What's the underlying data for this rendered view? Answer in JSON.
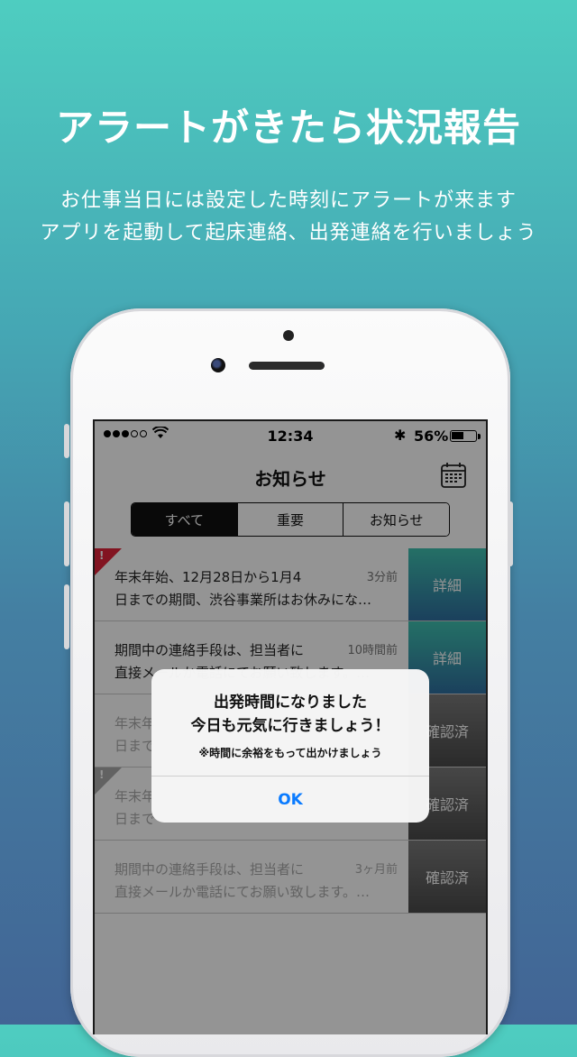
{
  "promo": {
    "headline": "アラートがきたら状況報告",
    "subtitle_line1": "お仕事当日には設定した時刻にアラートが来ます",
    "subtitle_line2": "アプリを起動して起床連絡、出発連絡を行いましょう"
  },
  "status_bar": {
    "time": "12:34",
    "battery_percent_label": "56%",
    "battery_level": 0.56,
    "signal_bars_filled": 3,
    "signal_bars_total": 5
  },
  "navbar": {
    "title": "お知らせ",
    "calendar_icon": "calendar-icon"
  },
  "segments": [
    {
      "label": "すべて",
      "selected": true
    },
    {
      "label": "重要",
      "selected": false
    },
    {
      "label": "お知らせ",
      "selected": false
    }
  ],
  "notices": [
    {
      "line1": "年末年始、12月28日から1月4",
      "line2": "日までの期間、渋谷事業所はお休みにな…",
      "time": "3分前",
      "action": "詳細",
      "flag": "!"
    },
    {
      "line1": "期間中の連絡手段は、担当者に",
      "line2": "直接メールか電話にてお願い致します。…",
      "time": "10時間前",
      "action": "詳細",
      "flag": ""
    },
    {
      "line1": "年末年",
      "line2": "日まで",
      "time": "",
      "action": "確認済",
      "flag": ""
    },
    {
      "line1": "年末年",
      "line2": "日まで",
      "time": "",
      "action": "確認済",
      "flag": "!"
    },
    {
      "line1": "期間中の連絡手段は、担当者に",
      "line2": "直接メールか電話にてお願い致します。…",
      "time": "3ヶ月前",
      "action": "確認済",
      "flag": ""
    }
  ],
  "alert": {
    "title_line1": "出発時間になりました",
    "title_line2": "今日も元気に行きましょう！",
    "message": "※時間に余裕をもって出かけましょう",
    "ok_label": "OK"
  },
  "colors": {
    "bg_top": "#4ecdc0",
    "bg_bottom": "#426595",
    "accent_ok": "#0a7bff",
    "flag_red": "#e0243a"
  }
}
